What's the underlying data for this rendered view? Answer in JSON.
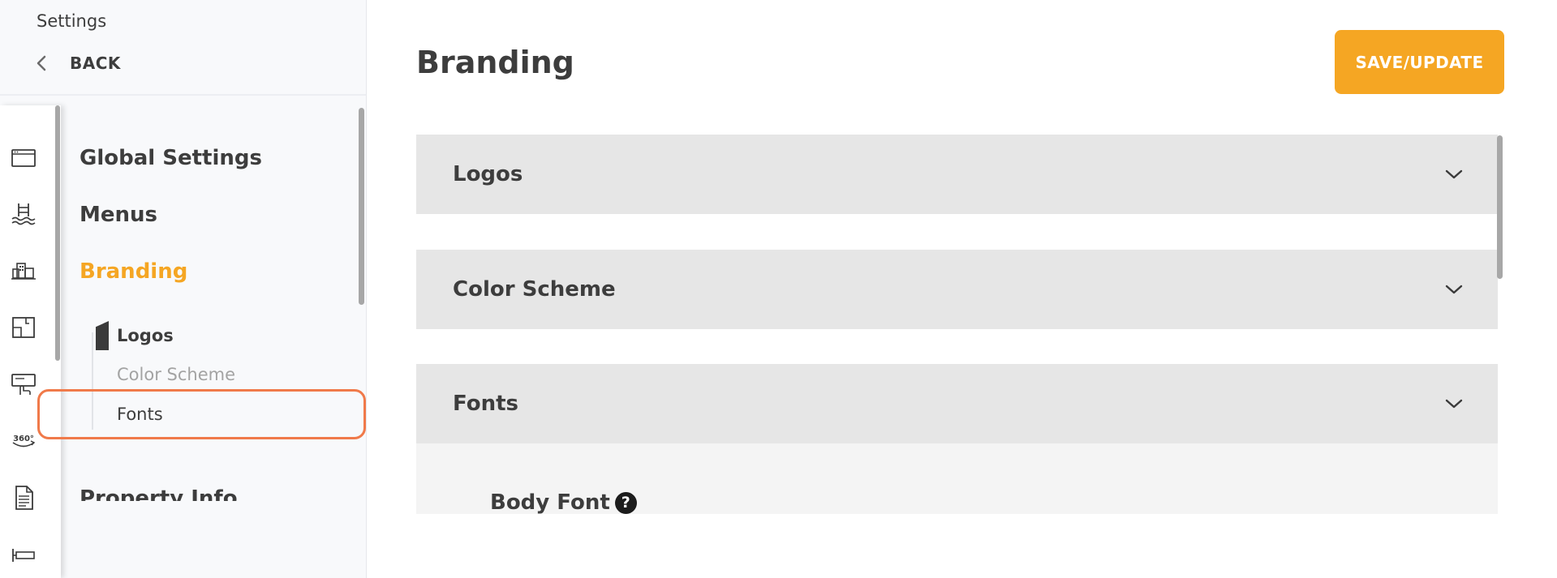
{
  "sidebar": {
    "heading": "Settings",
    "back_label": "BACK",
    "rail_icons": [
      "browser-window-icon",
      "pool-icon",
      "buildings-icon",
      "floorplan-icon",
      "touch-screen-icon",
      "360-view-icon",
      "document-icon",
      "sign-icon"
    ],
    "rail_360_text": "360°",
    "nav": {
      "global_settings": "Global Settings",
      "menus": "Menus",
      "branding": "Branding",
      "property_info": "Property Info"
    },
    "sub_items": {
      "logos": "Logos",
      "color_scheme": "Color Scheme",
      "fonts": "Fonts"
    }
  },
  "main": {
    "title": "Branding",
    "save_label": "SAVE/UPDATE",
    "sections": {
      "logos": "Logos",
      "color_scheme": "Color Scheme",
      "fonts": "Fonts"
    },
    "fonts_body": {
      "body_font_label": "Body Font",
      "help_icon_glyph": "?"
    }
  },
  "colors": {
    "accent": "#f5a623",
    "highlight_outline": "#f07a4a",
    "section_bg": "#e6e6e6",
    "text": "#3d3d3d"
  }
}
